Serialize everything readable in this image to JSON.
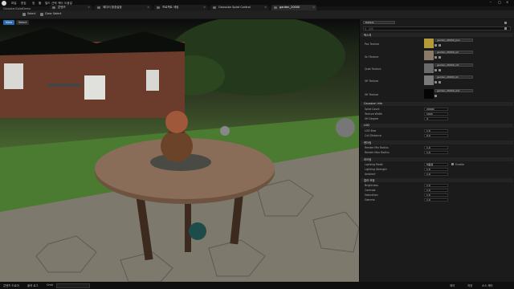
{
  "app": {
    "project_name": "GaussianSplatDemo",
    "menus": [
      "파일",
      "편집",
      "창",
      "툴",
      "빌드",
      "선택",
      "액터",
      "도움말"
    ]
  },
  "tabs": [
    {
      "label": "콘텐츠"
    },
    {
      "label": "에디터 환경설정"
    },
    {
      "label": "프로젝트 세팅"
    },
    {
      "label": "Gaussian Splat Control"
    },
    {
      "label": "garden_20000"
    }
  ],
  "toolbar": {
    "save_label": "Select",
    "clear_label": "Clear Select"
  },
  "viewport": {
    "mode_label": "View",
    "select_label": "Select"
  },
  "panel": {
    "search_placeholder": "검색",
    "top_dropdown": "Details",
    "sections": {
      "textures": "텍스처",
      "gaussian": "Gaussian Info",
      "lod": "LOD",
      "render": "렌더링",
      "lighting": "라이팅",
      "color": "컬러 보정"
    },
    "texture_rows": [
      {
        "label": "Pos Texture",
        "value": "garden_20000_pos"
      },
      {
        "label": "Scl Texture",
        "value": "garden_20000_scl"
      },
      {
        "label": "Quat Texture",
        "value": "garden_20000_rot"
      },
      {
        "label": "SH Texture",
        "value": "garden_20000_sh"
      },
      {
        "label": "SH Texture",
        "value": "garden_20000_sh1"
      }
    ],
    "info_rows": [
      {
        "label": "Splat Count",
        "value": "20000"
      },
      {
        "label": "Texture Width",
        "value": "1024"
      },
      {
        "label": "SH Degree",
        "value": "3"
      }
    ],
    "lod_rows": [
      {
        "label": "LOD Bias",
        "value": "1.0"
      },
      {
        "label": "Cull Distance",
        "value": "0.0"
      }
    ],
    "render_rows": [
      {
        "label": "Render Min Radius",
        "value": "1.0"
      },
      {
        "label": "Render Max Radius",
        "value": "1.0"
      }
    ],
    "lighting_rows": [
      {
        "label": "Lighting Mode",
        "value": "비활성"
      },
      {
        "label": "Lighting Strength",
        "value": "1.0"
      },
      {
        "label": "Ambient",
        "value": "1.0"
      }
    ],
    "color_rows": [
      {
        "label": "Brightness",
        "value": "1.0"
      },
      {
        "label": "Contrast",
        "value": "1.0"
      },
      {
        "label": "Saturation",
        "value": "1.0"
      },
      {
        "label": "Gamma",
        "value": "1.0"
      }
    ],
    "lighting_enable_label": "Enable"
  },
  "statusbar": {
    "items": [
      "콘텐츠 드로어",
      "출력 로그",
      "Cmd"
    ],
    "right_items": [
      "제어",
      "저장",
      "소스 제어"
    ]
  },
  "colors": {
    "accent": "#2b6cb0",
    "panel_bg": "#1b1b1b"
  }
}
